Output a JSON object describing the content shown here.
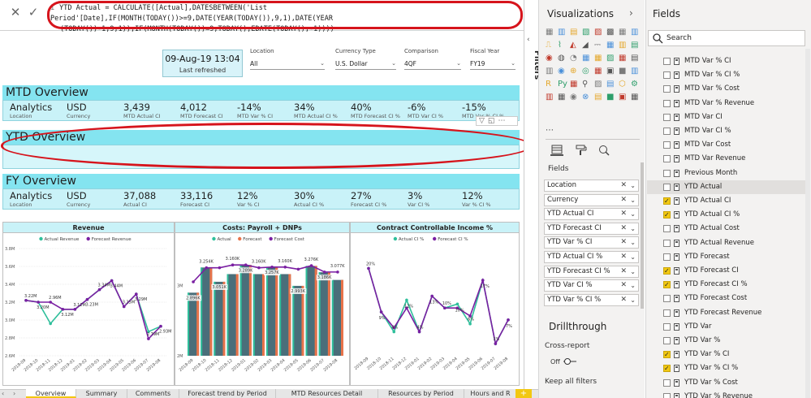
{
  "formula": {
    "line_no": "1",
    "line1": "YTD Actual = CALCULATE([Actual],DATESBETWEEN('List Period'[Date],IF(MONTH(TODAY())>=9,DATE(YEAR(TODAY()),9,1),DATE(YEAR",
    "line2": "(TODAY())-1,9,1)),IF(MONTH(TODAY())=9,TODAY(),EDATE(TODAY(),-1))))"
  },
  "timestamp_card": {
    "value": "09-Aug-19 13:04",
    "label": "Last refreshed"
  },
  "slicers": [
    {
      "label": "Location",
      "value": "All"
    },
    {
      "label": "Currency Type",
      "value": "U.S. Dollar"
    },
    {
      "label": "Comparison",
      "value": "4QF"
    },
    {
      "label": "Fiscal Year",
      "value": "FY19"
    }
  ],
  "mtd": {
    "title": "MTD Overview",
    "kpis": [
      {
        "v": "Analytics",
        "l": "Location"
      },
      {
        "v": "USD",
        "l": "Currency"
      },
      {
        "v": "3,439",
        "l": "MTD Actual CI"
      },
      {
        "v": "4,012",
        "l": "MTD Forecast CI"
      },
      {
        "v": "-14%",
        "l": "MTD Var % CI"
      },
      {
        "v": "34%",
        "l": "MTD Actual CI %"
      },
      {
        "v": "40%",
        "l": "MTD Forecast CI %"
      },
      {
        "v": "-6%",
        "l": "MTD Var CI %"
      },
      {
        "v": "-15%",
        "l": "MTD Var % CI %"
      }
    ]
  },
  "ytd": {
    "title": "YTD Overview"
  },
  "fy": {
    "title": "FY Overview",
    "kpis": [
      {
        "v": "Analytics",
        "l": "Location"
      },
      {
        "v": "USD",
        "l": "Currency"
      },
      {
        "v": "37,088",
        "l": "Actual CI"
      },
      {
        "v": "33,116",
        "l": "Forecast CI"
      },
      {
        "v": "12%",
        "l": "Var % CI"
      },
      {
        "v": "30%",
        "l": "Actual CI %"
      },
      {
        "v": "27%",
        "l": "Forecast CI %"
      },
      {
        "v": "3%",
        "l": "Var CI %"
      },
      {
        "v": "12%",
        "l": "Var % CI %"
      }
    ]
  },
  "chart_data": [
    {
      "type": "line",
      "title": "Revenue",
      "x": [
        "2018-09",
        "2018-10",
        "2018-11",
        "2018-12",
        "2019-01",
        "2019-02",
        "2019-03",
        "2019-04",
        "2019-05",
        "2019-06",
        "2019-07",
        "2019-08"
      ],
      "ylim": [
        2.6,
        3.8
      ],
      "yticks": [
        "2.6M",
        "2.8M",
        "3.0M",
        "3.2M",
        "3.4M",
        "3.6M",
        "3.8M"
      ],
      "series": [
        {
          "name": "Actual Revenue",
          "color": "#2fbf9b",
          "values": [
            3.22,
            3.2,
            2.96,
            3.12,
            3.12,
            3.23,
            3.34,
            3.44,
            3.15,
            3.29,
            2.87,
            2.93
          ]
        },
        {
          "name": "Forecast Revenue",
          "color": "#7a1fa2",
          "values": [
            3.22,
            3.2,
            3.2,
            3.12,
            3.12,
            3.23,
            3.34,
            3.44,
            3.15,
            3.29,
            2.79,
            2.93
          ]
        }
      ],
      "labels": [
        "3.22M",
        "3.20M",
        "2.96M",
        "3.12M",
        "3.12M",
        "3.23M",
        "3.34M",
        "3.44M",
        "3.15M",
        "3.29M",
        "2.79M",
        "2.93M"
      ]
    },
    {
      "type": "bar",
      "title": "Costs: Payroll + DNPs",
      "x": [
        "2018-09",
        "2018-10",
        "2018-11",
        "2018-12",
        "2019-01",
        "2019-02",
        "2019-03",
        "2019-04",
        "2019-05",
        "2019-06",
        "2019-07",
        "2019-08"
      ],
      "ylim": [
        2.0,
        3.5
      ],
      "yticks": [
        "2M",
        "3M"
      ],
      "series": [
        {
          "name": "Actual",
          "color": "#2fbf9b",
          "values": [
            2.896,
            3.254,
            3.051,
            3.16,
            3.289,
            3.16,
            3.257,
            3.16,
            2.993,
            3.276,
            3.186,
            3.077
          ]
        },
        {
          "name": "Forecast",
          "color": "#e8734a",
          "values": [
            2.896,
            3.254,
            3.051,
            3.16,
            3.289,
            3.16,
            3.257,
            3.16,
            2.993,
            3.276,
            3.186,
            3.077
          ]
        },
        {
          "name": "Forecast Cost",
          "color": "#7a1fa2",
          "values": [
            3.05,
            3.25,
            3.25,
            3.29,
            3.29,
            3.25,
            3.26,
            3.26,
            3.23,
            3.28,
            3.19,
            3.19
          ]
        }
      ],
      "labels": [
        "2.896K",
        "3.254K",
        "3.051K",
        "3.160K",
        "3.289K",
        "3.160K",
        "3.257K",
        "3.160K",
        "2.993K",
        "3.276K",
        "3.186K",
        "3.077K"
      ]
    },
    {
      "type": "line",
      "title": "Contract Controllable Income %",
      "x": [
        "2018-09",
        "2018-10",
        "2018-11",
        "2018-12",
        "2019-01",
        "2019-02",
        "2019-03",
        "2019-04",
        "2019-05",
        "2019-06",
        "2019-07",
        "2019-08"
      ],
      "ylim": [
        0,
        25
      ],
      "series": [
        {
          "name": "Actual CI %",
          "color": "#2fbf9b",
          "values": [
            20,
            9,
            4,
            12,
            4,
            13,
            10,
            11,
            6,
            17,
            1,
            7
          ]
        },
        {
          "name": "Forecast CI %",
          "color": "#7a1fa2",
          "values": [
            20,
            9,
            5,
            10,
            4,
            13,
            10,
            10,
            8,
            17,
            1,
            7
          ]
        }
      ],
      "labels": [
        "20%",
        "9%",
        "4%",
        "12%",
        "4%",
        "13%",
        "10%",
        "10%",
        "6%",
        "17%",
        "1%",
        "7%"
      ]
    }
  ],
  "filters": {
    "label": "Filters"
  },
  "viz": {
    "title": "Visualizations",
    "fields_label": "Fields",
    "wells": [
      "Location",
      "Currency",
      "YTD Actual CI",
      "YTD Forecast CI",
      "YTD Var % CI",
      "YTD Actual CI %",
      "YTD Forecast CI %",
      "YTD Var CI %",
      "YTD Var % CI %"
    ],
    "drill_title": "Drillthrough",
    "cross_report": "Cross-report",
    "toggle_off": "Off",
    "keep_filters": "Keep all filters"
  },
  "fields": {
    "title": "Fields",
    "search_placeholder": "Search",
    "items": [
      {
        "name": "MTD Var % CI",
        "checked": false
      },
      {
        "name": "MTD Var % CI %",
        "checked": false
      },
      {
        "name": "MTD Var % Cost",
        "checked": false
      },
      {
        "name": "MTD Var % Revenue",
        "checked": false
      },
      {
        "name": "MTD Var CI",
        "checked": false
      },
      {
        "name": "MTD Var CI %",
        "checked": false
      },
      {
        "name": "MTD Var Cost",
        "checked": false
      },
      {
        "name": "MTD Var Revenue",
        "checked": false
      },
      {
        "name": "Previous Month",
        "checked": false
      },
      {
        "name": "YTD Actual",
        "checked": false
      },
      {
        "name": "YTD Actual CI",
        "checked": true
      },
      {
        "name": "YTD Actual CI %",
        "checked": true
      },
      {
        "name": "YTD Actual Cost",
        "checked": false
      },
      {
        "name": "YTD Actual Revenue",
        "checked": false
      },
      {
        "name": "YTD Forecast",
        "checked": false
      },
      {
        "name": "YTD Forecast CI",
        "checked": true
      },
      {
        "name": "YTD Forecast CI %",
        "checked": true
      },
      {
        "name": "YTD Forecast Cost",
        "checked": false
      },
      {
        "name": "YTD Forecast Revenue",
        "checked": false
      },
      {
        "name": "YTD Var",
        "checked": false
      },
      {
        "name": "YTD Var %",
        "checked": false
      },
      {
        "name": "YTD Var % CI",
        "checked": true
      },
      {
        "name": "YTD Var % CI %",
        "checked": true
      },
      {
        "name": "YTD Var % Cost",
        "checked": false
      },
      {
        "name": "YTD Var % Revenue",
        "checked": false
      }
    ]
  },
  "tabs": [
    "Overview",
    "Summary",
    "Comments",
    "Forecast trend by Period",
    "MTD Resources Detail",
    "Resources by Period",
    "Hours and R"
  ],
  "tab_add": "+"
}
